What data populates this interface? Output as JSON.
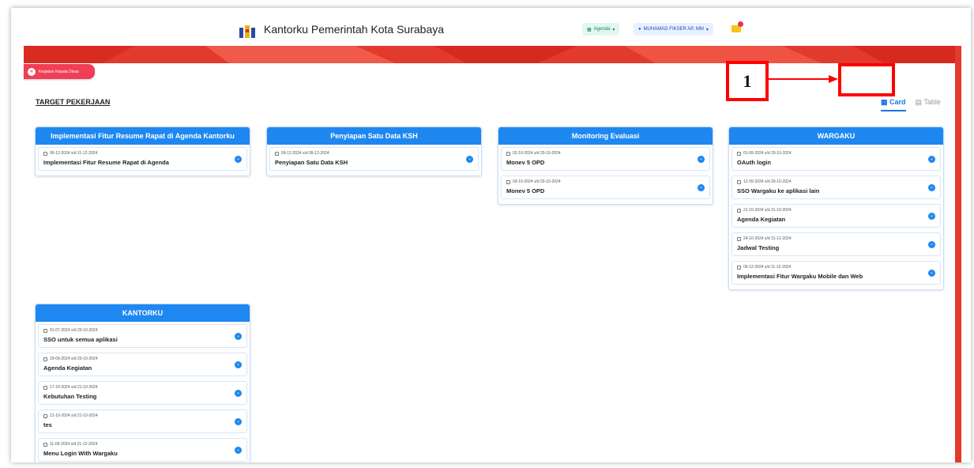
{
  "header": {
    "app_title": "Kantorku Pemerintah Kota Surabaya",
    "agenda_label": "Agenda",
    "user_label": "MUHAMAD FIKSER AP, MM"
  },
  "nav": {
    "back_label": "Kegiatan Kepala Dinas"
  },
  "page": {
    "heading": "TARGET PEKERJAAN"
  },
  "view_toggle": {
    "card_label": "Card",
    "table_label": "Table",
    "active": "Card"
  },
  "annotation": {
    "label": "1"
  },
  "columns": [
    {
      "title": "Implementasi Fitur Resume Rapat di Agenda Kantorku",
      "items": [
        {
          "date": "09-12-2024 s/d 11-12-2024",
          "title": "Implementasi Fitur Resume Rapat di Agenda"
        }
      ]
    },
    {
      "title": "Penyiapan Satu Data KSH",
      "items": [
        {
          "date": "09-12-2024 s/d 09-12-2024",
          "title": "Penyiapan Satu Data KSH"
        }
      ]
    },
    {
      "title": "Monitoring Evaluasi",
      "items": [
        {
          "date": "02-10-2024 s/d 29-10-2024",
          "title": "Monev 5 OPD"
        },
        {
          "date": "03-10-2024 s/d 29-10-2024",
          "title": "Monev 5 OPD"
        }
      ]
    },
    {
      "title": "WARGAKU",
      "items": [
        {
          "date": "01-09-2024 s/d 29-10-2024",
          "title": "OAuth login"
        },
        {
          "date": "12-09-2024 s/d 29-10-2024",
          "title": "SSO Wargaku ke aplikasi lain"
        },
        {
          "date": "21-10-2024 s/d 31-10-2024",
          "title": "Agenda Kegiatan"
        },
        {
          "date": "24-10-2024 s/d 31-12-2024",
          "title": "Jadwal Testing"
        },
        {
          "date": "09-12-2024 s/d 11-12-2024",
          "title": "Implementasi Fitur Wargaku Mobile dan Web"
        }
      ]
    },
    {
      "title": "KANTORKU",
      "items": [
        {
          "date": "01-07-2024 s/d 29-10-2024",
          "title": "SSO untuk semua aplikasi"
        },
        {
          "date": "29-09-2024 s/d 29-10-2024",
          "title": "Agenda Kegiatan"
        },
        {
          "date": "17-10-2024 s/d 21-10-2024",
          "title": "Kebutuhan Testing"
        },
        {
          "date": "21-10-2024 s/d 21-10-2024",
          "title": "tes"
        },
        {
          "date": "11-09-2024 s/d 21-12-2024",
          "title": "Menu Login With Wargaku"
        }
      ]
    }
  ]
}
